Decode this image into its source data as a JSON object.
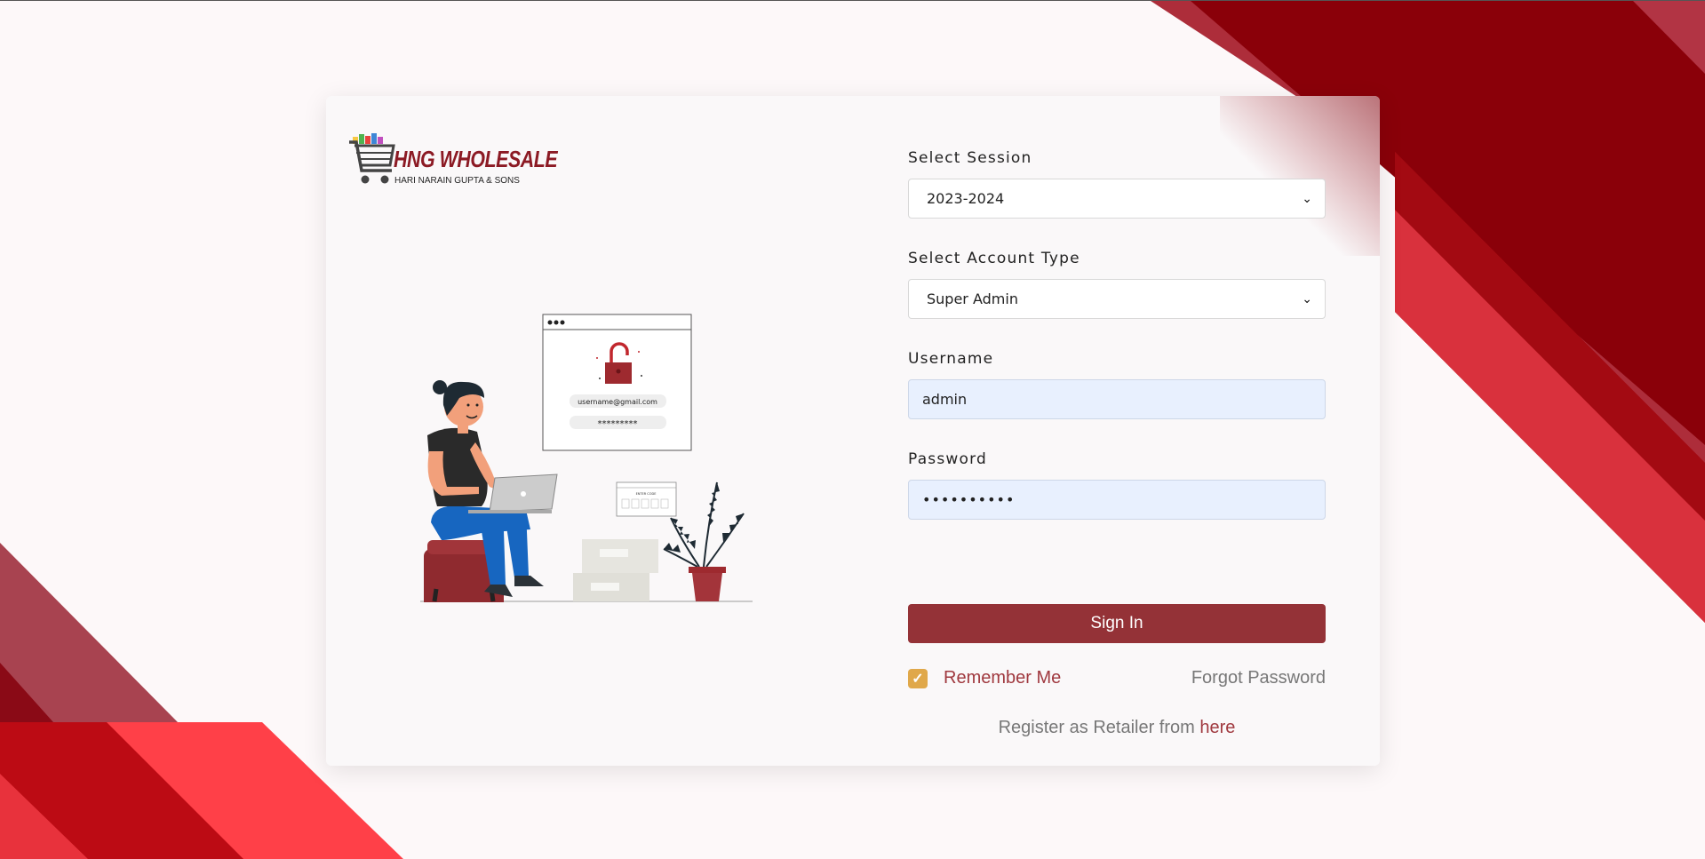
{
  "brand": {
    "name": "HNG WHOLESALE",
    "tagline": "HARI NARAIN GUPTA & SONS"
  },
  "illustration": {
    "email_text": "username@gmail.com",
    "password_text": "*********",
    "code_text": "ENTER CODE"
  },
  "form": {
    "session": {
      "label": "Select Session",
      "value": "2023-2024"
    },
    "account_type": {
      "label": "Select Account Type",
      "value": "Super Admin"
    },
    "username": {
      "label": "Username",
      "value": "admin"
    },
    "password": {
      "label": "Password",
      "value": "••••••••••"
    },
    "sign_in_label": "Sign In",
    "remember_label": "Remember Me",
    "remember_checked": true,
    "forgot_label": "Forgot Password",
    "register_text": "Register as Retailer from ",
    "register_link": "here"
  },
  "colors": {
    "primary": "#943237",
    "accent_check": "#e0a84a",
    "input_bg": "#e8f0fe",
    "bg_red_dark": "#8a0009",
    "bg_red": "#d9313d"
  }
}
